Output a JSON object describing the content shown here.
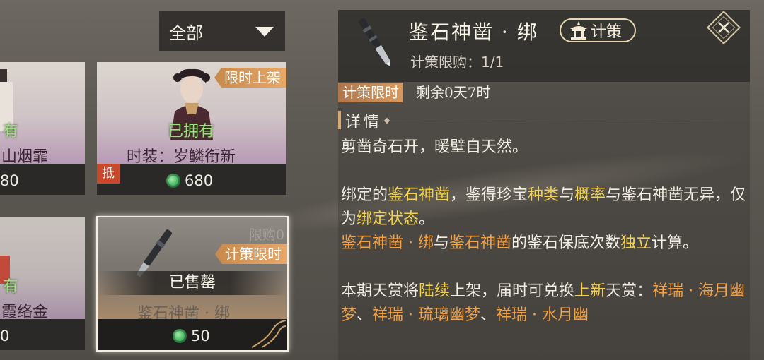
{
  "filter": {
    "label": "全部"
  },
  "cards": [
    {
      "status": "有",
      "name": "山烟霏",
      "price": "80"
    },
    {
      "tag": "限时上架",
      "status": "已拥有",
      "name": "时装：岁鳞衔新",
      "deduct": "抵",
      "price": "680"
    },
    {
      "status": "有",
      "name": "霞络金",
      "price": "0"
    },
    {
      "limit": "限购0",
      "tag": "计策限时",
      "status": "已售罄",
      "name": "鉴石神凿 · 绑",
      "price": "50"
    }
  ],
  "detail": {
    "title": "鉴石神凿 · 绑",
    "badge": "计策",
    "limit_label": "计策限购：",
    "limit_value": "1/1",
    "timer_tag": "计策限时",
    "timer_text": "剩余0天7时",
    "section": "详情",
    "para1": "剪凿奇石开，暖壁自天然。",
    "para2": [
      {
        "t": "绑定的",
        "c": ""
      },
      {
        "t": "鉴石神凿",
        "c": "y"
      },
      {
        "t": "，鉴得珍宝",
        "c": ""
      },
      {
        "t": "种类",
        "c": "y"
      },
      {
        "t": "与",
        "c": ""
      },
      {
        "t": "概率",
        "c": "y"
      },
      {
        "t": "与鉴石神凿无异，仅为",
        "c": ""
      },
      {
        "t": "绑定状态",
        "c": "y"
      },
      {
        "t": "。",
        "c": ""
      }
    ],
    "para3": [
      {
        "t": "鉴石神凿 · 绑",
        "c": "o"
      },
      {
        "t": "与",
        "c": ""
      },
      {
        "t": "鉴石神凿",
        "c": "o"
      },
      {
        "t": "的鉴石保底次数",
        "c": ""
      },
      {
        "t": "独立",
        "c": "y"
      },
      {
        "t": "计算。",
        "c": ""
      }
    ],
    "para4": [
      {
        "t": "本期天赏将",
        "c": ""
      },
      {
        "t": "陆续",
        "c": "y"
      },
      {
        "t": "上架，届时可兑换",
        "c": ""
      },
      {
        "t": "上新",
        "c": "y"
      },
      {
        "t": "天赏：",
        "c": ""
      },
      {
        "t": "祥瑞 · 海月幽梦",
        "c": "o"
      },
      {
        "t": "、",
        "c": ""
      },
      {
        "t": "祥瑞 · 琉璃幽梦",
        "c": "o"
      },
      {
        "t": "、",
        "c": ""
      },
      {
        "t": "祥瑞 · 水月幽",
        "c": "o"
      }
    ]
  },
  "colors": {
    "highlight_yellow": "#f2d24e",
    "highlight_orange": "#f1a044",
    "owned_green": "#9be07e",
    "tag_orange": "#d89a62"
  }
}
